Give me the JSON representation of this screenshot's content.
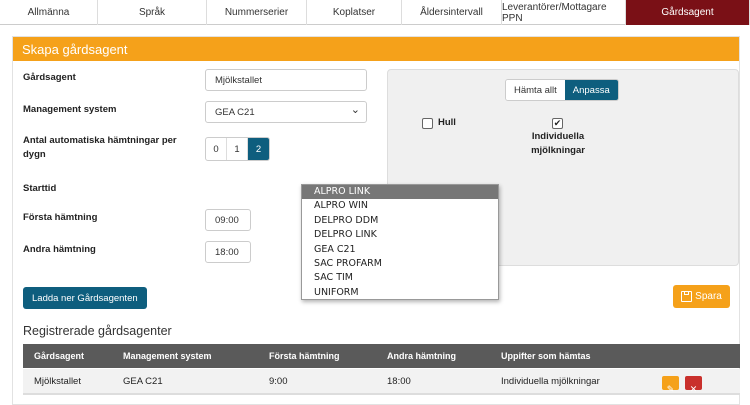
{
  "tabs": [
    {
      "label": "Allmänna"
    },
    {
      "label": "Språk"
    },
    {
      "label": "Nummerserier"
    },
    {
      "label": "Koplatser"
    },
    {
      "label": "Åldersintervall"
    },
    {
      "label": "Leverantörer/Mottagare PPN"
    },
    {
      "label": "Gårdsagent"
    }
  ],
  "panel": {
    "title": "Skapa gårdsagent"
  },
  "form": {
    "agent_label": "Gårdsagent",
    "agent_value": "Mjölkstallet",
    "management_label": "Management system",
    "management_value": "GEA C21",
    "auto_fetch_label_1": "Antal automatiska hämtningar per",
    "auto_fetch_label_2": "dygn",
    "auto_fetch_options": [
      "0",
      "1",
      "2"
    ],
    "auto_fetch_selected": "2",
    "starttid_label": "Starttid",
    "first_fetch_label": "Första hämtning",
    "first_fetch_value": "09:00",
    "second_fetch_label": "Andra hämtning",
    "second_fetch_value": "18:00"
  },
  "fetch_options": {
    "fetch_all": "Hämta allt",
    "customize": "Anpassa",
    "hull_label": "Hull",
    "hull_checked": false,
    "individual_label_1": "Individuella",
    "individual_label_2": "mjölkningar",
    "individual_checked": true
  },
  "dropdown": {
    "options": [
      "ALPRO LINK",
      "ALPRO WIN",
      "DELPRO DDM",
      "DELPRO LINK",
      "GEA C21",
      "SAC PROFARM",
      "SAC TIM",
      "UNIFORM"
    ],
    "highlighted": "ALPRO LINK"
  },
  "buttons": {
    "download": "Ladda ner Gårdsagenten",
    "save": "Spara"
  },
  "registered": {
    "title": "Registrerade gårdsagenter",
    "headers": [
      "Gårdsagent",
      "Management system",
      "Första hämtning",
      "Andra hämtning",
      "Uppifter som hämtas"
    ],
    "rows": [
      [
        "Mjölkstallet",
        "GEA C21",
        "9:00",
        "18:00",
        "Individuella mjölkningar"
      ]
    ]
  },
  "colors": {
    "accent": "#f5a11a",
    "primary": "#0e5e7e",
    "active_tab": "#7a1016",
    "danger": "#c9302c"
  }
}
